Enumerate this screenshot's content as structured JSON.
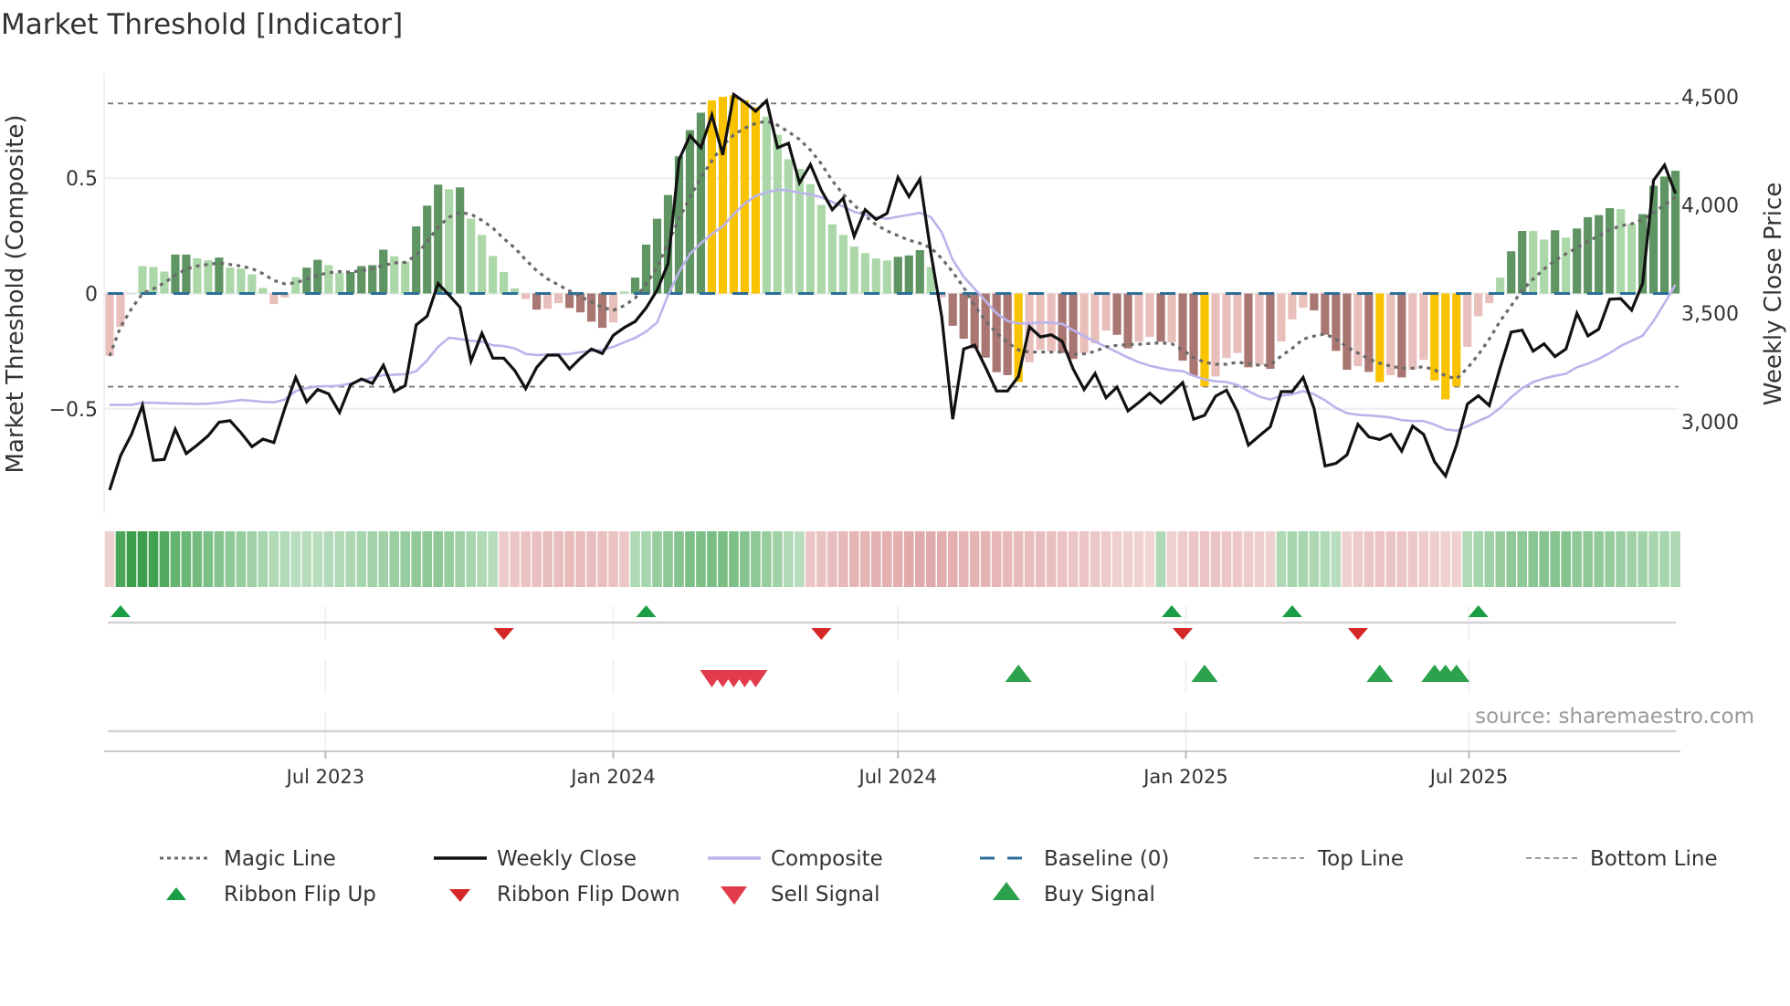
{
  "title": "Market Threshold [Indicator]",
  "source": "source: sharemaestro.com",
  "colors": {
    "bar_up_strong": "#5f9463",
    "bar_up_weak": "#acd7a8",
    "bar_down_weak": "#e9bfbb",
    "bar_down_strong": "#a97672",
    "bar_extreme": "#f9c300",
    "weekly_close": "#111111",
    "composite": "#bcb3ec",
    "magic_line": "#6a6a6a",
    "baseline": "#2b6f99",
    "threshold_lines": "#7a7a7a",
    "ribbon_green_light": "#e2f2e3",
    "ribbon_green_dark": "#3a9e4a",
    "ribbon_red_light": "#f6e2e2",
    "ribbon_red_dark": "#d48686",
    "flip_up": "#1a9e45",
    "flip_down": "#d62728",
    "sell_signal": "#e23b4b",
    "buy_signal": "#2ca24c",
    "grid": "#eef0f3"
  },
  "chart_data": {
    "type": "bar",
    "title": "Market Threshold [Indicator]",
    "xlabel": "",
    "ylabel": "Market Threshold (Composite)",
    "y2label": "Weekly Close Price",
    "ylim": [
      -0.956,
      0.952
    ],
    "y2lim": [
      2573,
      4606
    ],
    "grid": true,
    "legend_position": "bottom",
    "x_start": "2023-02-13",
    "x_step_days": 7,
    "yticks": [
      {
        "value": 0.5,
        "label": "0.5"
      },
      {
        "value": 0,
        "label": "0"
      },
      {
        "value": -0.5,
        "label": "−0.5"
      }
    ],
    "y2ticks": [
      {
        "value": 4500,
        "label": "4,500"
      },
      {
        "value": 4000,
        "label": "4,000"
      },
      {
        "value": 3500,
        "label": "3,500"
      },
      {
        "value": 3000,
        "label": "3,000"
      }
    ],
    "xticks": [
      {
        "date": "2023-07-01",
        "label": "Jul 2023"
      },
      {
        "date": "2024-01-01",
        "label": "Jan 2024"
      },
      {
        "date": "2024-07-01",
        "label": "Jul 2024"
      },
      {
        "date": "2025-01-01",
        "label": "Jan 2025"
      },
      {
        "date": "2025-07-01",
        "label": "Jul 2025"
      }
    ],
    "top_line": 0.824,
    "bottom_line": -0.404,
    "baseline": 0,
    "histogram": [
      -0.27,
      -0.145,
      0,
      0.119,
      0.115,
      0.095,
      0.169,
      0.169,
      0.153,
      0.144,
      0.156,
      0.112,
      0.108,
      0.083,
      0.024,
      -0.046,
      -0.017,
      0.071,
      0.112,
      0.146,
      0.123,
      0.09,
      0.093,
      0.119,
      0.123,
      0.19,
      0.161,
      0.139,
      0.291,
      0.381,
      0.472,
      0.452,
      0.46,
      0.324,
      0.254,
      0.163,
      0.093,
      0.022,
      -0.024,
      -0.07,
      -0.066,
      -0.042,
      -0.063,
      -0.082,
      -0.122,
      -0.149,
      -0.126,
      0.009,
      0.069,
      0.212,
      0.324,
      0.427,
      0.595,
      0.708,
      0.784,
      0.837,
      0.853,
      0.86,
      0.837,
      0.807,
      0.767,
      0.688,
      0.582,
      0.54,
      0.474,
      0.384,
      0.3,
      0.254,
      0.204,
      0.175,
      0.152,
      0.143,
      0.159,
      0.165,
      0.188,
      0.115,
      -0.017,
      -0.14,
      -0.196,
      -0.238,
      -0.278,
      -0.341,
      -0.354,
      -0.384,
      -0.298,
      -0.245,
      -0.251,
      -0.258,
      -0.284,
      -0.258,
      -0.216,
      -0.161,
      -0.179,
      -0.238,
      -0.209,
      -0.188,
      -0.209,
      -0.212,
      -0.291,
      -0.357,
      -0.403,
      -0.36,
      -0.28,
      -0.258,
      -0.32,
      -0.311,
      -0.327,
      -0.208,
      -0.112,
      -0.062,
      -0.073,
      -0.179,
      -0.249,
      -0.331,
      -0.315,
      -0.34,
      -0.384,
      -0.354,
      -0.364,
      -0.331,
      -0.288,
      -0.377,
      -0.459,
      -0.403,
      -0.231,
      -0.099,
      -0.042,
      0.069,
      0.183,
      0.271,
      0.271,
      0.234,
      0.274,
      0.242,
      0.282,
      0.331,
      0.34,
      0.37,
      0.366,
      0.302,
      0.344,
      0.467,
      0.507,
      0.532
    ],
    "histogram_class": [
      "P",
      "P",
      "L",
      "L",
      "L",
      "L",
      "D",
      "D",
      "L",
      "L",
      "D",
      "L",
      "L",
      "L",
      "L",
      "P",
      "P",
      "L",
      "D",
      "D",
      "L",
      "L",
      "D",
      "D",
      "D",
      "D",
      "L",
      "L",
      "D",
      "D",
      "D",
      "L",
      "D",
      "L",
      "L",
      "L",
      "L",
      "L",
      "P",
      "R",
      "P",
      "P",
      "R",
      "R",
      "R",
      "R",
      "P",
      "L",
      "D",
      "D",
      "D",
      "D",
      "D",
      "D",
      "D",
      "Y",
      "Y",
      "Y",
      "Y",
      "Y",
      "L",
      "L",
      "L",
      "L",
      "L",
      "L",
      "L",
      "L",
      "L",
      "L",
      "L",
      "L",
      "D",
      "D",
      "D",
      "L",
      "P",
      "R",
      "R",
      "R",
      "R",
      "R",
      "R",
      "Y",
      "P",
      "P",
      "P",
      "R",
      "R",
      "P",
      "P",
      "P",
      "R",
      "R",
      "P",
      "P",
      "R",
      "P",
      "R",
      "R",
      "Y",
      "P",
      "P",
      "P",
      "R",
      "P",
      "R",
      "P",
      "P",
      "P",
      "R",
      "R",
      "R",
      "R",
      "P",
      "R",
      "Y",
      "P",
      "R",
      "P",
      "P",
      "Y",
      "Y",
      "Y",
      "P",
      "P",
      "P",
      "L",
      "D",
      "D",
      "L",
      "L",
      "D",
      "L",
      "D",
      "D",
      "D",
      "D",
      "L",
      "L",
      "D",
      "D",
      "D",
      "D"
    ],
    "weekly_close": [
      2683,
      2842,
      2941,
      3074,
      2821,
      2825,
      2965,
      2852,
      2891,
      2934,
      2997,
      3004,
      2948,
      2884,
      2919,
      2903,
      3060,
      3204,
      3091,
      3148,
      3128,
      3042,
      3170,
      3197,
      3176,
      3260,
      3138,
      3166,
      3446,
      3487,
      3638,
      3584,
      3528,
      3279,
      3408,
      3293,
      3293,
      3236,
      3152,
      3250,
      3307,
      3307,
      3243,
      3293,
      3335,
      3314,
      3398,
      3434,
      3462,
      3525,
      3607,
      3730,
      4209,
      4321,
      4265,
      4416,
      4232,
      4511,
      4476,
      4434,
      4483,
      4265,
      4286,
      4103,
      4187,
      4068,
      3979,
      4032,
      3856,
      3979,
      3934,
      3962,
      4128,
      4039,
      4120,
      3779,
      3483,
      3011,
      3335,
      3353,
      3250,
      3141,
      3141,
      3208,
      3438,
      3391,
      3401,
      3370,
      3243,
      3148,
      3222,
      3110,
      3159,
      3049,
      3089,
      3131,
      3086,
      3131,
      3180,
      3011,
      3029,
      3117,
      3145,
      3046,
      2891,
      2934,
      2976,
      3138,
      3138,
      3204,
      3060,
      2795,
      2807,
      2846,
      2987,
      2929,
      2917,
      2941,
      2863,
      2979,
      2941,
      2814,
      2748,
      2891,
      3081,
      3119,
      3074,
      3250,
      3413,
      3422,
      3325,
      3359,
      3300,
      3335,
      3500,
      3396,
      3427,
      3565,
      3568,
      3515,
      3638,
      4114,
      4185,
      4054
    ],
    "composite": [
      -0.483,
      -0.483,
      -0.483,
      -0.474,
      -0.474,
      -0.476,
      -0.477,
      -0.478,
      -0.479,
      -0.478,
      -0.474,
      -0.468,
      -0.462,
      -0.465,
      -0.47,
      -0.472,
      -0.46,
      -0.423,
      -0.41,
      -0.403,
      -0.402,
      -0.4,
      -0.39,
      -0.377,
      -0.365,
      -0.354,
      -0.352,
      -0.35,
      -0.337,
      -0.29,
      -0.231,
      -0.192,
      -0.198,
      -0.205,
      -0.209,
      -0.225,
      -0.228,
      -0.238,
      -0.262,
      -0.267,
      -0.265,
      -0.263,
      -0.263,
      -0.254,
      -0.25,
      -0.245,
      -0.231,
      -0.212,
      -0.192,
      -0.165,
      -0.126,
      -0.007,
      0.093,
      0.172,
      0.218,
      0.258,
      0.291,
      0.344,
      0.39,
      0.423,
      0.439,
      0.45,
      0.447,
      0.437,
      0.43,
      0.417,
      0.397,
      0.377,
      0.354,
      0.341,
      0.331,
      0.324,
      0.333,
      0.341,
      0.35,
      0.331,
      0.265,
      0.146,
      0.073,
      0.02,
      -0.033,
      -0.086,
      -0.119,
      -0.13,
      -0.13,
      -0.126,
      -0.126,
      -0.132,
      -0.159,
      -0.185,
      -0.209,
      -0.231,
      -0.254,
      -0.278,
      -0.298,
      -0.313,
      -0.324,
      -0.333,
      -0.337,
      -0.357,
      -0.373,
      -0.381,
      -0.384,
      -0.397,
      -0.423,
      -0.447,
      -0.46,
      -0.443,
      -0.437,
      -0.423,
      -0.437,
      -0.463,
      -0.496,
      -0.519,
      -0.526,
      -0.529,
      -0.533,
      -0.538,
      -0.549,
      -0.553,
      -0.553,
      -0.569,
      -0.589,
      -0.595,
      -0.575,
      -0.553,
      -0.532,
      -0.496,
      -0.45,
      -0.41,
      -0.384,
      -0.368,
      -0.357,
      -0.348,
      -0.32,
      -0.304,
      -0.284,
      -0.258,
      -0.228,
      -0.205,
      -0.183,
      -0.119,
      -0.042,
      0.037
    ],
    "magic_line": [
      -0.271,
      -0.145,
      -0.066,
      0,
      0.02,
      0.046,
      0.079,
      0.106,
      0.119,
      0.126,
      0.132,
      0.126,
      0.119,
      0.108,
      0.086,
      0.056,
      0.042,
      0.046,
      0.063,
      0.079,
      0.09,
      0.095,
      0.093,
      0.099,
      0.108,
      0.122,
      0.132,
      0.135,
      0.165,
      0.225,
      0.288,
      0.331,
      0.351,
      0.344,
      0.317,
      0.284,
      0.238,
      0.198,
      0.146,
      0.099,
      0.063,
      0.037,
      0.011,
      -0.013,
      -0.037,
      -0.06,
      -0.073,
      -0.053,
      -0.02,
      0.04,
      0.112,
      0.218,
      0.324,
      0.417,
      0.503,
      0.575,
      0.642,
      0.688,
      0.717,
      0.738,
      0.747,
      0.73,
      0.701,
      0.668,
      0.622,
      0.562,
      0.489,
      0.43,
      0.384,
      0.337,
      0.298,
      0.271,
      0.251,
      0.231,
      0.218,
      0.198,
      0.152,
      0.093,
      0.026,
      -0.053,
      -0.119,
      -0.172,
      -0.212,
      -0.245,
      -0.254,
      -0.254,
      -0.254,
      -0.254,
      -0.265,
      -0.262,
      -0.251,
      -0.231,
      -0.225,
      -0.222,
      -0.22,
      -0.217,
      -0.214,
      -0.218,
      -0.245,
      -0.278,
      -0.298,
      -0.307,
      -0.307,
      -0.298,
      -0.304,
      -0.311,
      -0.311,
      -0.271,
      -0.238,
      -0.198,
      -0.185,
      -0.175,
      -0.198,
      -0.231,
      -0.258,
      -0.284,
      -0.302,
      -0.315,
      -0.324,
      -0.324,
      -0.317,
      -0.331,
      -0.357,
      -0.37,
      -0.324,
      -0.265,
      -0.198,
      -0.119,
      -0.053,
      0.013,
      0.063,
      0.106,
      0.143,
      0.172,
      0.198,
      0.225,
      0.251,
      0.275,
      0.294,
      0.302,
      0.32,
      0.351,
      0.384,
      0.417
    ],
    "ribbon": [
      -0.2,
      0.9,
      1.0,
      1.0,
      0.95,
      0.85,
      0.75,
      0.7,
      0.65,
      0.6,
      0.55,
      0.5,
      0.45,
      0.4,
      0.35,
      0.3,
      0.28,
      0.25,
      0.25,
      0.25,
      0.28,
      0.3,
      0.32,
      0.35,
      0.38,
      0.4,
      0.42,
      0.45,
      0.48,
      0.5,
      0.5,
      0.45,
      0.4,
      0.35,
      0.3,
      0.25,
      -0.25,
      -0.3,
      -0.35,
      -0.38,
      -0.4,
      -0.4,
      -0.42,
      -0.42,
      -0.4,
      -0.38,
      -0.35,
      -0.3,
      0.3,
      0.35,
      0.45,
      0.5,
      0.55,
      0.6,
      0.6,
      0.62,
      0.62,
      0.6,
      0.55,
      0.5,
      0.45,
      0.4,
      0.3,
      0.25,
      -0.3,
      -0.35,
      -0.4,
      -0.45,
      -0.5,
      -0.5,
      -0.52,
      -0.55,
      -0.55,
      -0.6,
      -0.6,
      -0.6,
      -0.58,
      -0.55,
      -0.5,
      -0.5,
      -0.5,
      -0.48,
      -0.45,
      -0.42,
      -0.4,
      -0.4,
      -0.38,
      -0.35,
      -0.32,
      -0.3,
      -0.28,
      -0.25,
      -0.22,
      -0.2,
      -0.18,
      -0.15,
      0.3,
      -0.2,
      -0.25,
      -0.3,
      -0.32,
      -0.32,
      -0.3,
      -0.28,
      -0.25,
      -0.22,
      -0.2,
      0.3,
      0.35,
      0.35,
      0.32,
      0.3,
      0.25,
      -0.2,
      -0.25,
      -0.3,
      -0.32,
      -0.32,
      -0.3,
      -0.28,
      -0.25,
      -0.22,
      -0.2,
      -0.18,
      0.3,
      0.35,
      0.4,
      0.45,
      0.5,
      0.5,
      0.52,
      0.55,
      0.55,
      0.55,
      0.5,
      0.5,
      0.48,
      0.45,
      0.42,
      0.4,
      0.38,
      0.35,
      0.35,
      0.32
    ],
    "ribbon_flip_up": [
      1,
      49,
      97,
      108,
      125
    ],
    "ribbon_flip_down": [
      36,
      65,
      98,
      114
    ],
    "sell_signals": [
      55,
      56,
      57,
      58,
      59
    ],
    "buy_signals": [
      83,
      100,
      116,
      121,
      122,
      123
    ],
    "legend": [
      {
        "key": "magic_line",
        "label": "Magic Line"
      },
      {
        "key": "weekly_close",
        "label": "Weekly Close"
      },
      {
        "key": "composite",
        "label": "Composite"
      },
      {
        "key": "baseline",
        "label": "Baseline (0)"
      },
      {
        "key": "top_line",
        "label": "Top Line"
      },
      {
        "key": "bottom_line",
        "label": "Bottom Line"
      },
      {
        "key": "ribbon_flip_up",
        "label": "Ribbon Flip Up"
      },
      {
        "key": "ribbon_flip_down",
        "label": "Ribbon Flip Down"
      },
      {
        "key": "sell_signal",
        "label": "Sell Signal"
      },
      {
        "key": "buy_signal",
        "label": "Buy Signal"
      }
    ]
  }
}
